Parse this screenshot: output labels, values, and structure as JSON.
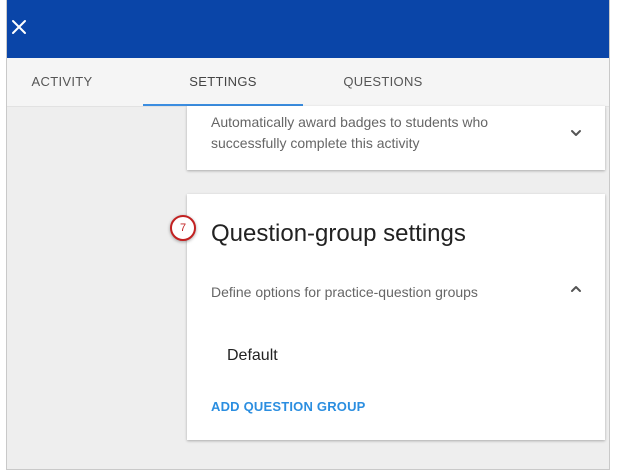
{
  "header": {
    "close_icon": "close-icon",
    "background_color": "#0a45a8"
  },
  "tabs": [
    {
      "label": "ACTIVITY",
      "active": false
    },
    {
      "label": "SETTINGS",
      "active": true
    },
    {
      "label": "QUESTIONS",
      "active": false
    }
  ],
  "badges_card": {
    "description": "Automatically award badges to students who successfully complete this activity",
    "toggle_icon": "chevron-down-icon"
  },
  "question_group_card": {
    "title": "Question-group settings",
    "description": "Define options for practice-question groups",
    "toggle_icon": "chevron-up-icon",
    "groups": [
      "Default"
    ],
    "add_label": "ADD QUESTION GROUP"
  },
  "annotation": {
    "step_number": "7",
    "color": "#c22121"
  },
  "colors": {
    "accent": "#2b8ee0",
    "tab_indicator": "#3b8de0",
    "background": "#eeeeee"
  }
}
